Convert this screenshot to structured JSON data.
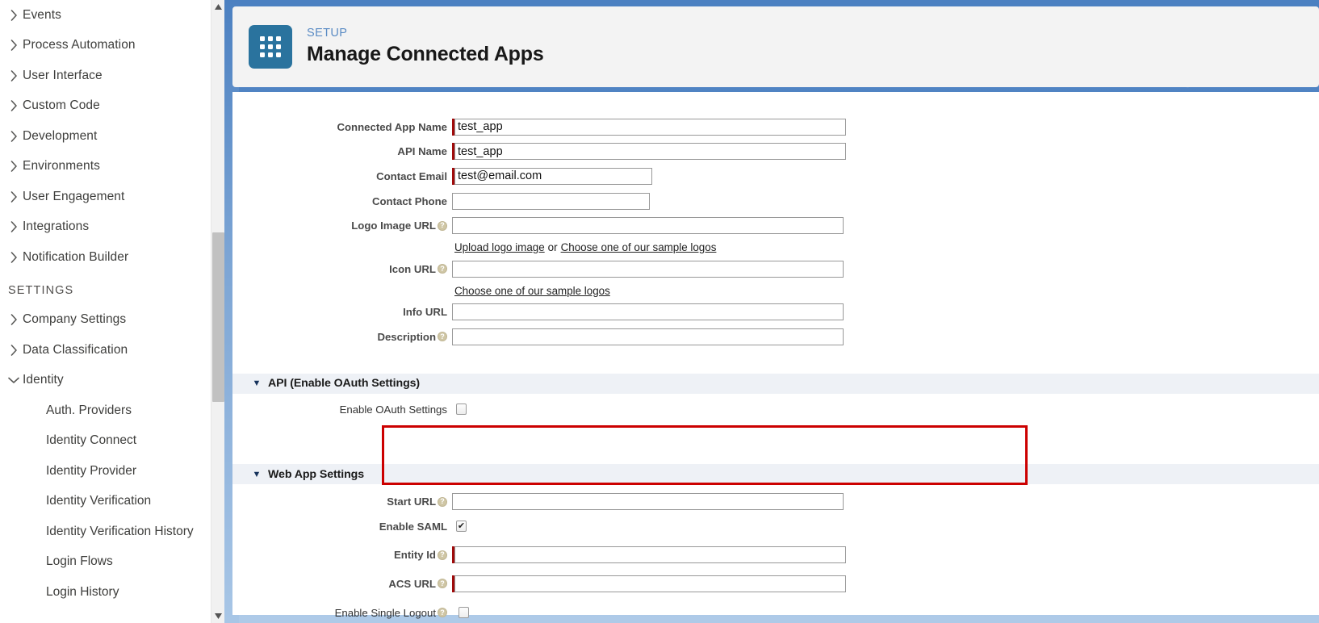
{
  "sidebar": {
    "nav_items": [
      {
        "label": "Events",
        "expanded": false
      },
      {
        "label": "Process Automation",
        "expanded": false
      },
      {
        "label": "User Interface",
        "expanded": false
      },
      {
        "label": "Custom Code",
        "expanded": false
      },
      {
        "label": "Development",
        "expanded": false
      },
      {
        "label": "Environments",
        "expanded": false
      },
      {
        "label": "User Engagement",
        "expanded": false
      },
      {
        "label": "Integrations",
        "expanded": false
      },
      {
        "label": "Notification Builder",
        "expanded": false
      }
    ],
    "settings_heading": "SETTINGS",
    "settings_items": [
      {
        "label": "Company Settings",
        "expanded": false
      },
      {
        "label": "Data Classification",
        "expanded": false
      },
      {
        "label": "Identity",
        "expanded": true
      }
    ],
    "identity_children": [
      {
        "label": "Auth. Providers"
      },
      {
        "label": "Identity Connect"
      },
      {
        "label": "Identity Provider"
      },
      {
        "label": "Identity Verification"
      },
      {
        "label": "Identity Verification History"
      },
      {
        "label": "Login Flows"
      },
      {
        "label": "Login History"
      }
    ]
  },
  "header": {
    "eyebrow": "SETUP",
    "title": "Manage Connected Apps",
    "icon": "app-grid-icon",
    "icon_color": "#2a739e",
    "accent_color": "#5a8bc4"
  },
  "form": {
    "basic_fields": [
      {
        "label": "Connected App Name",
        "value": "test_app",
        "placeholder": "",
        "required": true,
        "help": false,
        "width": "wide"
      },
      {
        "label": "API Name",
        "value": "test_app",
        "placeholder": "",
        "required": true,
        "help": false,
        "width": "wide"
      },
      {
        "label": "Contact Email",
        "value": "test@email.com",
        "placeholder": "",
        "required": true,
        "help": false,
        "width": "mid"
      },
      {
        "label": "Contact Phone",
        "value": "",
        "placeholder": "",
        "required": false,
        "help": false,
        "width": "mid"
      }
    ],
    "logo_field": {
      "label": "Logo Image URL",
      "value": "",
      "required": false,
      "help": true,
      "width": "wide"
    },
    "logo_links": {
      "upload": "Upload logo image",
      "conjunction": "or",
      "choose": "Choose one of our sample logos"
    },
    "icon_field": {
      "label": "Icon URL",
      "value": "",
      "required": false,
      "help": true,
      "width": "wide"
    },
    "icon_links": {
      "choose": "Choose one of our sample logos"
    },
    "info_field": {
      "label": "Info URL",
      "value": "",
      "required": false,
      "help": false,
      "width": "wide"
    },
    "description_field": {
      "label": "Description",
      "value": "",
      "required": false,
      "help": true,
      "width": "wide"
    },
    "api_section": {
      "title": "API (Enable OAuth Settings)",
      "toggle": "collapse-triangle-icon",
      "oauth_row": {
        "label": "Enable OAuth Settings",
        "checked": false,
        "help": false
      }
    },
    "web_section": {
      "title": "Web App Settings",
      "toggle": "collapse-triangle-icon",
      "start_url": {
        "label": "Start URL",
        "value": "",
        "required": false,
        "help": true,
        "width": "wide"
      },
      "enable_saml": {
        "label": "Enable SAML",
        "checked": true,
        "help": false
      },
      "entity_id": {
        "label": "Entity Id",
        "value": "",
        "required": true,
        "help": true,
        "width": "wide"
      },
      "acs_url": {
        "label": "ACS URL",
        "value": "",
        "required": true,
        "help": true,
        "width": "wide"
      },
      "single_logout": {
        "label": "Enable Single Logout",
        "checked": false,
        "help": true
      }
    }
  },
  "annotation": {
    "color": "#cc0000",
    "target": "entity-id-and-acs-url-rows"
  },
  "glyphs": {
    "help": "?",
    "check": "✔",
    "triangle_down": "▼",
    "chevron_right": "›",
    "chevron_down": "⌄"
  }
}
